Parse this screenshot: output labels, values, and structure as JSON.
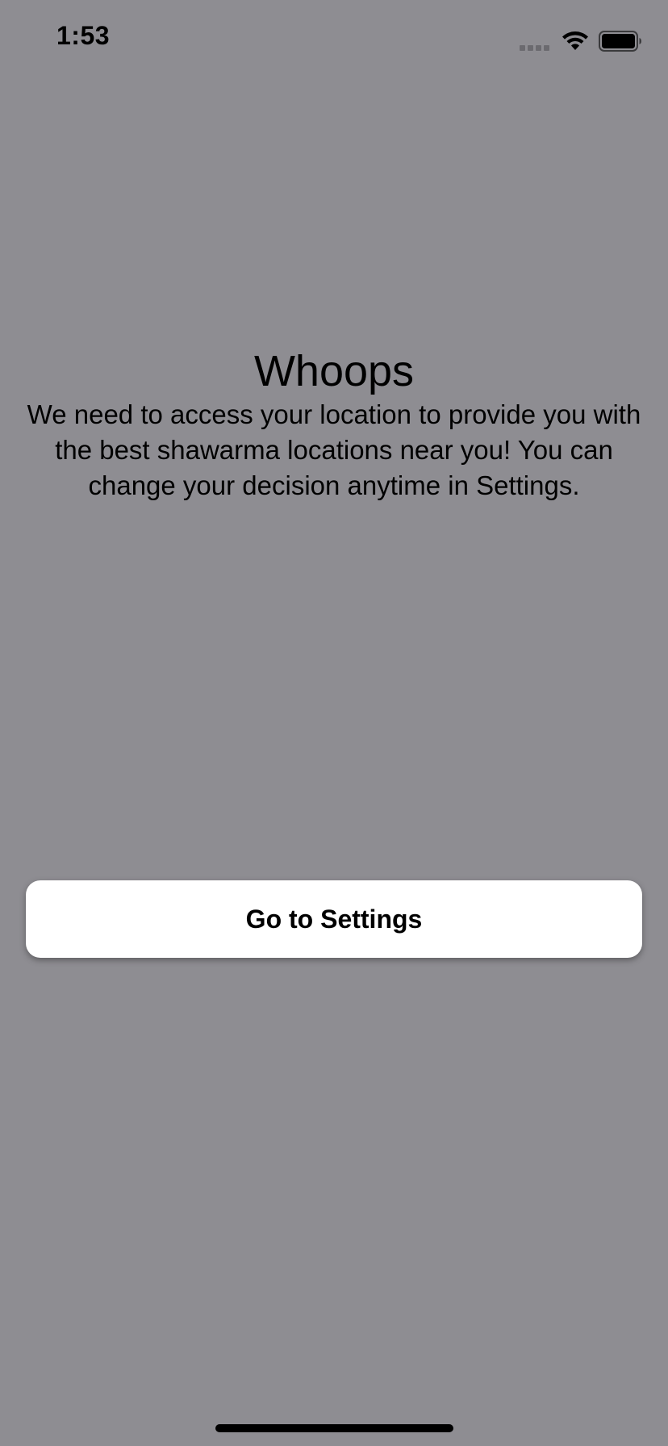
{
  "status_bar": {
    "time": "1:53",
    "icons": [
      "cellular-signal-icon",
      "wifi-icon",
      "battery-icon"
    ]
  },
  "main": {
    "title": "Whoops",
    "message": "We need to access your location to provide you with the best shawarma locations near you! You can change your decision anytime in Settings."
  },
  "actions": {
    "settings_button_label": "Go to Settings"
  },
  "colors": {
    "background": "#8e8d92",
    "button_background": "#ffffff",
    "text": "#000000"
  }
}
